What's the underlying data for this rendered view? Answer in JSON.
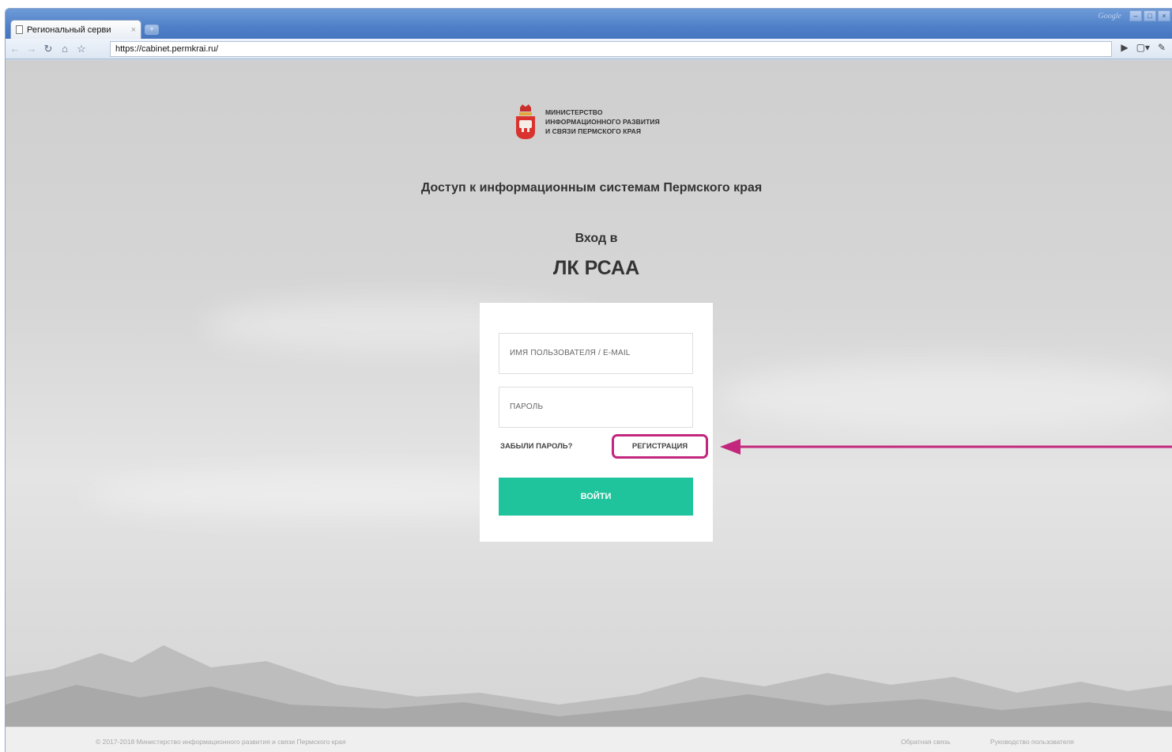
{
  "browser": {
    "tab_title": "Региональный серви",
    "tab_close": "×",
    "new_tab": "+",
    "titlebar_label": "Google",
    "url": "https://cabinet.permkrai.ru/"
  },
  "brand": {
    "line1": "МИНИСТЕРСТВО",
    "line2": "ИНФОРМАЦИОННОГО РАЗВИТИЯ",
    "line3": "И СВЯЗИ ПЕРМСКОГО КРАЯ"
  },
  "page": {
    "title": "Доступ к информационным системам Пермского края",
    "login_prefix": "Вход в",
    "login_target": "ЛК РСАА"
  },
  "form": {
    "username_placeholder": "ИМЯ ПОЛЬЗОВАТЕЛЯ / E-MAIL",
    "password_placeholder": "ПАРОЛЬ",
    "forgot_label": "ЗАБЫЛИ ПАРОЛЬ?",
    "register_label": "РЕГИСТРАЦИЯ",
    "submit_label": "ВОЙТИ"
  },
  "footer": {
    "copyright": "© 2017-2018 Министерство информационного развития и связи Пермского края",
    "feedback": "Обратная связь",
    "guide": "Руководство пользователя"
  },
  "colors": {
    "accent": "#1fc39c",
    "highlight": "#c2277d"
  }
}
